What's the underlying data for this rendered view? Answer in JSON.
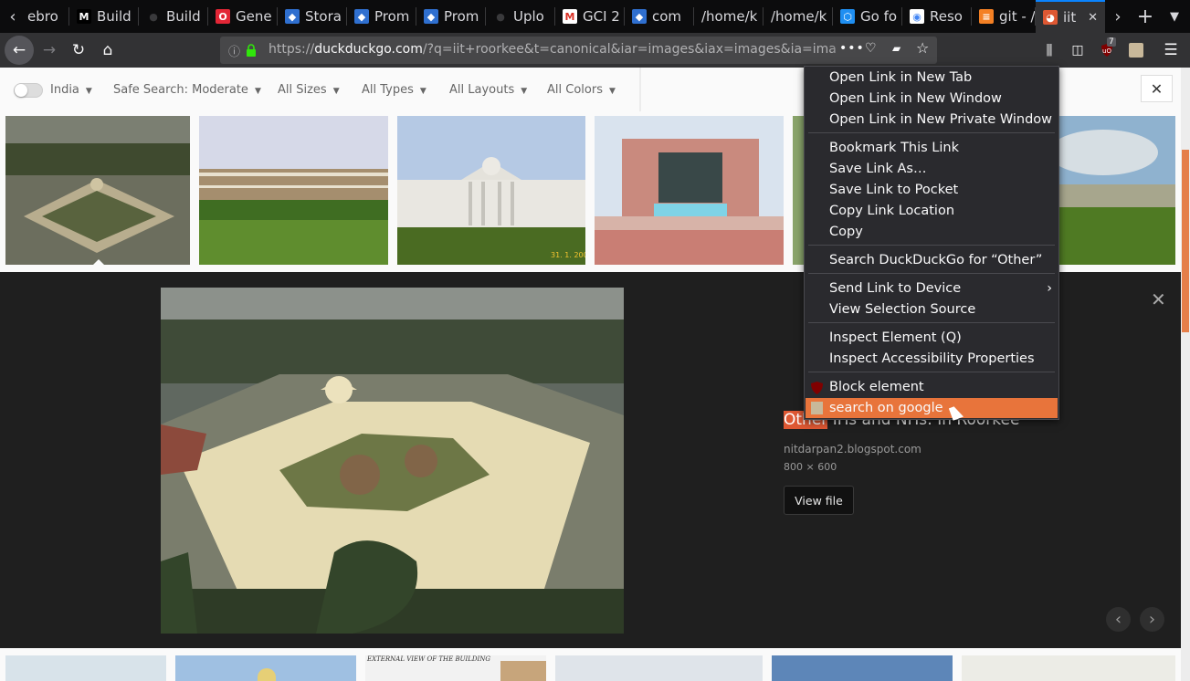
{
  "tabs": [
    {
      "title": "Algebro",
      "display": "ebro",
      "icon": "generic-tab-icon",
      "color": "#0c0c0d"
    },
    {
      "title": "Build",
      "display": "Build",
      "icon": "medium-m-icon",
      "color": "#000000"
    },
    {
      "title": "Build",
      "display": "Build",
      "icon": "github-icon",
      "color": "#0c0c0d"
    },
    {
      "title": "Gene",
      "display": "Gene",
      "icon": "opera-icon",
      "color": "#e32636"
    },
    {
      "title": "Stora",
      "display": "Stora",
      "icon": "gitlab-doc-icon",
      "color": "#2f6fcf"
    },
    {
      "title": "Prom",
      "display": "Prom",
      "icon": "gitlab-doc-icon",
      "color": "#2f6fcf"
    },
    {
      "title": "Prom",
      "display": "Prom",
      "icon": "gitlab-doc-icon",
      "color": "#2f6fcf"
    },
    {
      "title": "Uplo",
      "display": "Uplo",
      "icon": "github-icon",
      "color": "#0c0c0d"
    },
    {
      "title": "GCI 2",
      "display": "GCI 2",
      "icon": "gmail-icon",
      "color": "#ffffff"
    },
    {
      "title": "com",
      "display": "com",
      "icon": "gitlab-doc-icon",
      "color": "#2f6fcf"
    },
    {
      "title": "/home/",
      "display": "/home/k",
      "icon": "none",
      "color": "#0c0c0d"
    },
    {
      "title": "/home/",
      "display": "/home/k",
      "icon": "none",
      "color": "#0c0c0d"
    },
    {
      "title": "Go fo",
      "display": "Go fo",
      "icon": "hexagon-icon",
      "color": "#1f8ff2"
    },
    {
      "title": "Reso",
      "display": "Reso",
      "icon": "chrome-icon",
      "color": "#ffffff"
    },
    {
      "title": "git",
      "display": "git - /",
      "icon": "stackoverflow-icon",
      "color": "#f48024"
    },
    {
      "title": "iit",
      "display": "iit",
      "icon": "duckduckgo-icon",
      "color": "#de5833"
    }
  ],
  "toolbar": {
    "url_domain": "duckduckgo.com",
    "url_prefix": "https://",
    "url_rest": "/?q=iit+roorkee&t=canonical&iar=images&iax=images&ia=ima",
    "ublock_count": "7"
  },
  "filters": {
    "region": "India",
    "safe_search": "Safe Search: Moderate",
    "sizes": "All Sizes",
    "types": "All Types",
    "layouts": "All Layouts",
    "colors": "All Colors"
  },
  "detail": {
    "title_highlight": "Other",
    "title_rest": "IITs and NITs: In Roorkee",
    "source": "nitdarpan2.blogspot.com",
    "dimensions": "800 × 600",
    "view_file": "View file"
  },
  "bottom_caption": "EXTERNAL VIEW OF THE BUILDING",
  "context_menu": {
    "groups": [
      [
        "Open Link in New Tab",
        "Open Link in New Window",
        "Open Link in New Private Window"
      ],
      [
        "Bookmark This Link",
        "Save Link As…",
        "Save Link to Pocket",
        "Copy Link Location",
        "Copy"
      ],
      [
        "Search DuckDuckGo for “Other”"
      ],
      [
        "Send Link to Device",
        "View Selection Source"
      ],
      [
        "Inspect Element (Q)",
        "Inspect Accessibility Properties"
      ],
      [
        "Block element",
        "search on google"
      ]
    ],
    "highlighted": "search on google"
  },
  "thumb_stamp": "31. 1. 2007"
}
